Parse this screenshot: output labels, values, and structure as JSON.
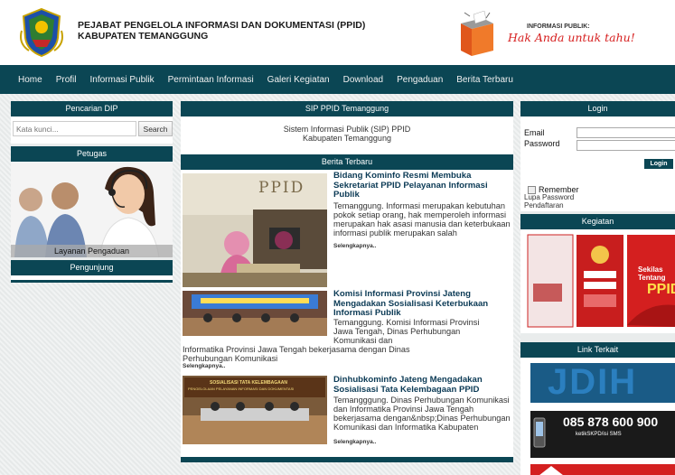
{
  "header": {
    "title_line1": "PEJABAT PENGELOLA INFORMASI DAN DOKUMENTASI (PPID)",
    "title_line2": "KABUPATEN TEMANGGUNG",
    "promo_label": "INFORMASI PUBLIK:",
    "promo_slogan": "Hak Anda untuk tahu!"
  },
  "nav": [
    "Home",
    "Profil",
    "Informasi Publik",
    "Permintaan Informasi",
    "Galeri Kegiatan",
    "Download",
    "Pengaduan",
    "Berita Terbaru"
  ],
  "left": {
    "search_title": "Pencarian DIP",
    "search_placeholder": "Kata kunci...",
    "search_button": "Search",
    "petugas_title": "Petugas",
    "petugas_caption": "Layanan Pengaduan",
    "pengunjung_title": "Pengunjung"
  },
  "center": {
    "sip_title": "SIP PPID Temanggung",
    "sip_line1": "Sistem Informasi Publik (SIP) PPID",
    "sip_line2": "Kabupaten Temanggung",
    "berita_title": "Berita Terbaru",
    "news": [
      {
        "title": "Bidang Kominfo Resmi Membuka Sekretariat PPID Pelayanan Informasi Publik",
        "text": "Temanggung. Informasi merupakan kebutuhan pokok setiap orang, hak memperoleh informasi merupakan hak asasi manusia dan keterbukaan informasi publik merupakan salah",
        "more": "Selengkapnya..",
        "thumb_text": "PPID"
      },
      {
        "title": "Komisi Informasi Provinsi Jateng Mengadakan Sosialisasi Keterbukaan Informasi Publik",
        "text_short": "Temanggung. Komisi Informasi Provinsi Jawa Tengah, Dinas Perhubungan Komunikasi dan",
        "text_long": "Informatika Provinsi Jawa Tengah bekerjasama dengan Dinas Perhubungan Komunikasi",
        "more": "Selengkapnya.."
      },
      {
        "title": "Dinhubkominfo Jateng Mengadakan Sosialisasi Tata Kelembagaan PPID",
        "text": "Temangggung. Dinas Perhubungan Komunikasi dan Informatika Provinsi Jawa Tengah bekerjasama dengan&nbsp;Dinas Perhubungan Komunikasi dan Informatika Kabupaten",
        "more": "Selengkapnya..",
        "banner_line1": "SOSIALISASI TATA KELEMBAGAAN",
        "banner_line2": "PENGELOLAAN PELAYANAN INFORMASI DAN DOKUMENTASI"
      }
    ]
  },
  "right": {
    "login_title": "Login",
    "email_label": "Email",
    "password_label": "Password",
    "login_button": "Login",
    "remember_label": "Remember",
    "lupa_password": "Lupa Password",
    "pendaftaran": "Pendaftaran",
    "kegiatan_title": "Kegiatan",
    "kegiatan_book_text1": "Sekilas",
    "kegiatan_book_text2": "Tentang",
    "kegiatan_book_text3": "PPID",
    "link_title": "Link Terkait",
    "jdih_text": "JDIH",
    "sms_number": "085 878 600 900",
    "sms_sub": "ketikSKPD/isi SMS"
  },
  "colors": {
    "nav_bg": "#0b4654",
    "title_link": "#0b3a55",
    "slogan": "#d61f1f"
  }
}
